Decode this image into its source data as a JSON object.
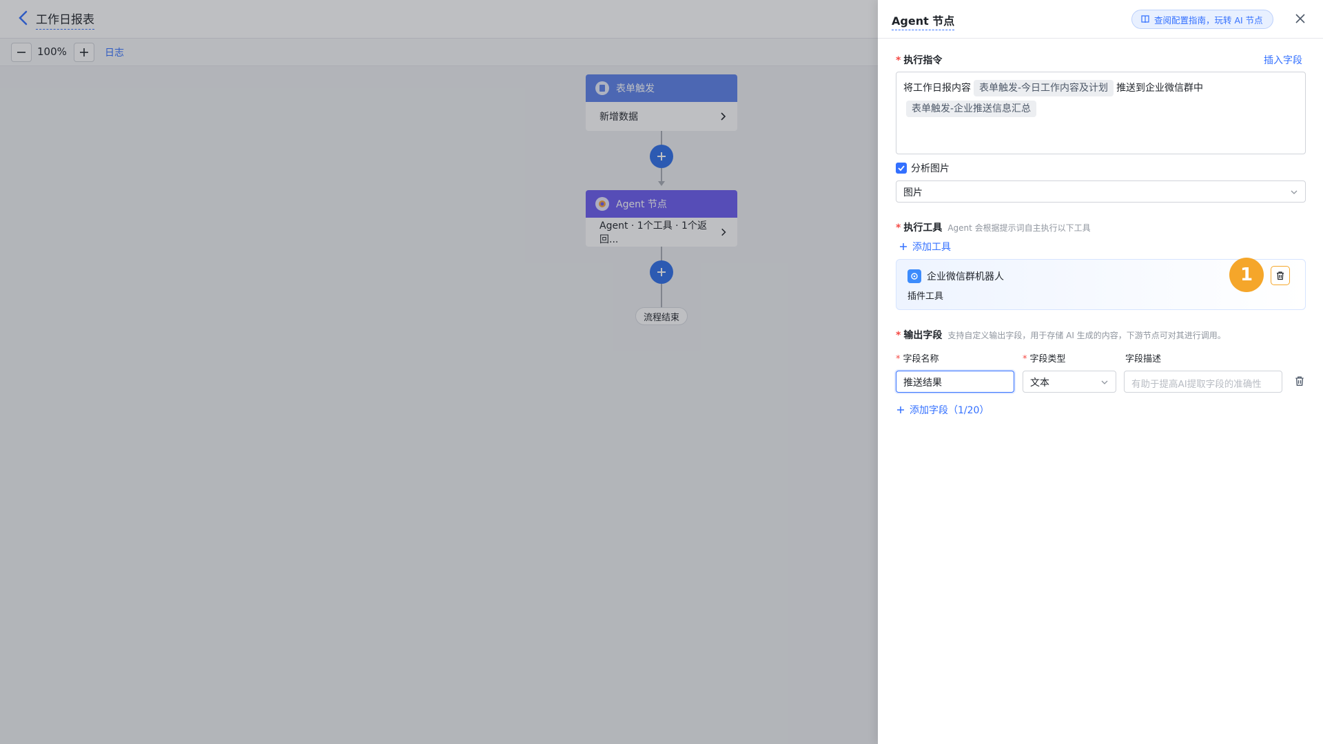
{
  "canvas": {
    "title": "工作日报表",
    "zoom": "100%",
    "log_label": "日志",
    "nodes": {
      "trigger": {
        "header": "表单触发",
        "body": "新增数据"
      },
      "agent": {
        "header": "Agent 节点",
        "body": "Agent · 1个工具 · 1个返回..."
      },
      "end": "流程结束"
    }
  },
  "drawer": {
    "title": "Agent 节点",
    "guide_label": "查阅配置指南，玩转 AI 节点",
    "instruction": {
      "label": "执行指令",
      "insert_field": "插入字段",
      "text_before": "将工作日报内容",
      "chip_1": "表单触发-今日工作内容及计划",
      "text_middle": "推送到企业微信群中",
      "chip_2": "表单触发-企业推送信息汇总"
    },
    "analyze_image": {
      "label": "分析图片",
      "checked": true,
      "select_value": "图片"
    },
    "tools": {
      "label": "执行工具",
      "hint": "Agent 会根据提示词自主执行以下工具",
      "add_label": "添加工具",
      "items": [
        {
          "name": "企业微信群机器人",
          "type": "插件工具",
          "badge": "1",
          "icon": "wecom-robot-icon"
        }
      ]
    },
    "output": {
      "label": "输出字段",
      "hint": "支持自定义输出字段，用于存储 AI 生成的内容，下游节点可对其进行调用。",
      "columns": {
        "name": "字段名称",
        "type": "字段类型",
        "desc": "字段描述"
      },
      "row": {
        "name_value": "推送结果",
        "type_value": "文本",
        "desc_placeholder": "有助于提高AI提取字段的准确性"
      },
      "add_label": "添加字段（1/20）"
    }
  },
  "colors": {
    "accent": "#3370ff",
    "trigger_header": "#5c82ea",
    "agent_header": "#6a5cf0",
    "badge": "#f5a62a",
    "required": "#f54a45"
  }
}
